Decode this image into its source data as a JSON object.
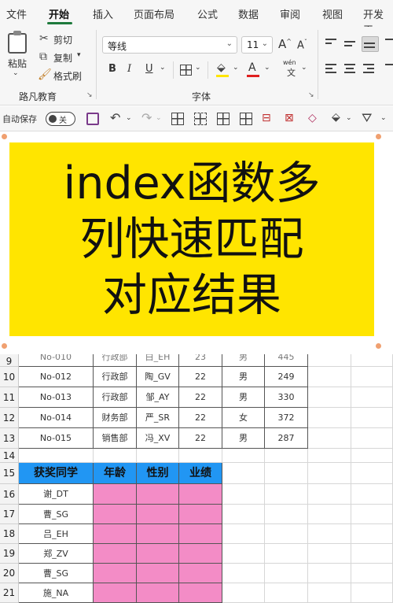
{
  "menu": {
    "tabs": [
      "文件",
      "开始",
      "插入",
      "页面布局",
      "公式",
      "数据",
      "审阅",
      "视图",
      "开发工"
    ],
    "active": "开始"
  },
  "ribbon": {
    "clipboard": {
      "paste_label": "粘贴",
      "cut_label": "剪切",
      "copy_label": "复制",
      "format_painter_label": "格式刷",
      "group_label": "路凡教育"
    },
    "font": {
      "font_name": "等线",
      "font_size": "11",
      "bold": "B",
      "italic": "I",
      "underline": "U",
      "grow": "A",
      "shrink": "A",
      "font_color_letter": "A",
      "phonetic": "wén",
      "phonetic_sub": "文",
      "group_label": "字体"
    }
  },
  "qat": {
    "autosave_label": "自动保存",
    "autosave_state": "关"
  },
  "banner": {
    "lines": [
      "index函数多",
      "列快速匹配",
      "对应结果"
    ]
  },
  "sheet": {
    "partial_row": {
      "num": "9",
      "cells": [
        "No-010",
        "行政部",
        "白_EH",
        "23",
        "男",
        "445"
      ]
    },
    "rows": [
      {
        "num": "10",
        "cells": [
          "No-012",
          "行政部",
          "陶_GV",
          "22",
          "男",
          "249"
        ]
      },
      {
        "num": "11",
        "cells": [
          "No-013",
          "行政部",
          "邹_AY",
          "22",
          "男",
          "330"
        ]
      },
      {
        "num": "12",
        "cells": [
          "No-014",
          "财务部",
          "严_SR",
          "22",
          "女",
          "372"
        ]
      },
      {
        "num": "13",
        "cells": [
          "No-015",
          "销售部",
          "冯_XV",
          "22",
          "男",
          "287"
        ]
      }
    ],
    "empty_row": {
      "num": "14"
    },
    "award_header": {
      "num": "15",
      "cells": [
        "获奖同学",
        "年龄",
        "性别",
        "业绩"
      ]
    },
    "award_rows": [
      {
        "num": "16",
        "name": "谢_DT"
      },
      {
        "num": "17",
        "name": "曹_SG"
      },
      {
        "num": "18",
        "name": "吕_EH"
      },
      {
        "num": "19",
        "name": "郑_ZV"
      },
      {
        "num": "20",
        "name": "曹_SG"
      },
      {
        "num": "21",
        "name": "施_NA"
      }
    ]
  },
  "colors": {
    "banner": "#ffe500",
    "header_fill": "#2196f3",
    "pink_fill": "#f38cc6",
    "active_tab_underline": "#1e7a3c"
  }
}
